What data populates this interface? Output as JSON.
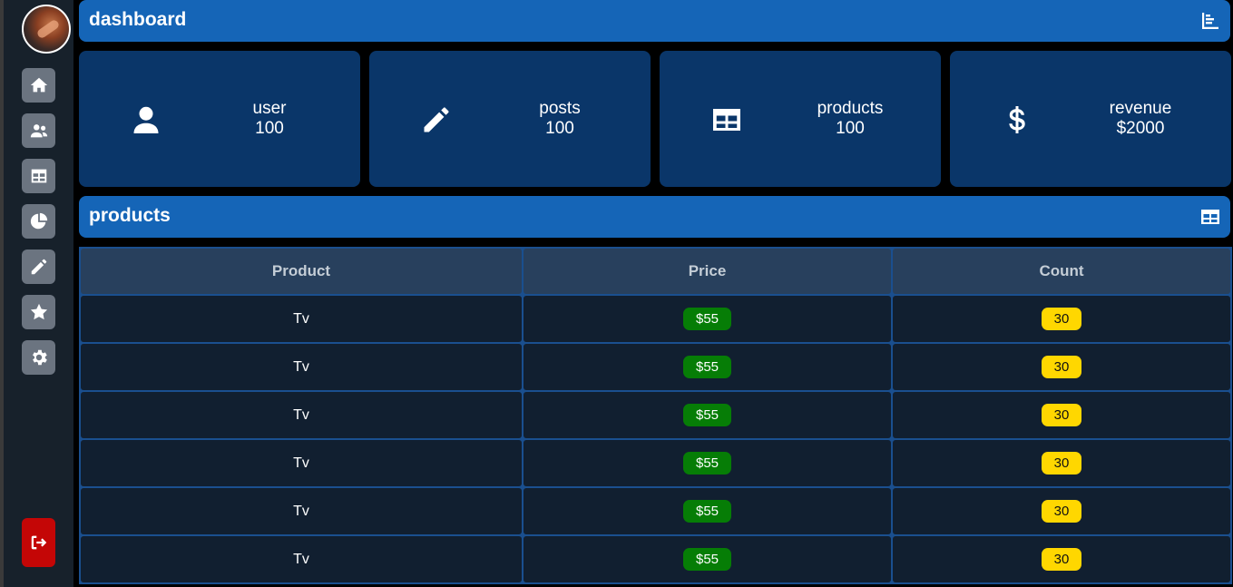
{
  "sidebar": {
    "items": [
      {
        "icon": "home-icon"
      },
      {
        "icon": "users-icon"
      },
      {
        "icon": "table-icon"
      },
      {
        "icon": "pie-chart-icon"
      },
      {
        "icon": "pencil-icon"
      },
      {
        "icon": "star-icon"
      },
      {
        "icon": "gear-icon"
      }
    ],
    "logout_icon": "logout-icon"
  },
  "dashboard": {
    "title": "dashboard",
    "icon": "bar-chart-icon"
  },
  "cards": [
    {
      "icon": "user-icon",
      "label": "user",
      "value": "100"
    },
    {
      "icon": "pencil-icon",
      "label": "posts",
      "value": "100"
    },
    {
      "icon": "table-icon",
      "label": "products",
      "value": "100"
    },
    {
      "icon": "dollar-icon",
      "label": "revenue",
      "value": "$2000"
    }
  ],
  "products": {
    "title": "products",
    "icon": "table-icon",
    "columns": [
      "Product",
      "Price",
      "Count"
    ],
    "rows": [
      {
        "product": "Tv",
        "price": "$55",
        "count": "30"
      },
      {
        "product": "Tv",
        "price": "$55",
        "count": "30"
      },
      {
        "product": "Tv",
        "price": "$55",
        "count": "30"
      },
      {
        "product": "Tv",
        "price": "$55",
        "count": "30"
      },
      {
        "product": "Tv",
        "price": "$55",
        "count": "30"
      },
      {
        "product": "Tv",
        "price": "$55",
        "count": "30"
      }
    ]
  },
  "colors": {
    "header_bar": "#1565b7",
    "card": "#0a3669",
    "price_badge": "#067d06",
    "count_badge": "#ffd700",
    "logout": "#c40606"
  }
}
